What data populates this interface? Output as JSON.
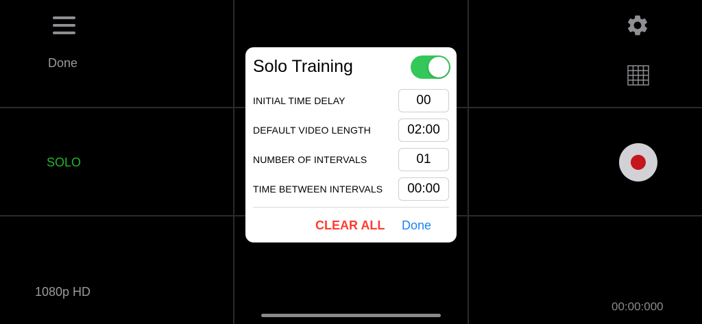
{
  "left_panel": {
    "done_label": "Done",
    "mode_label": "SOLO",
    "resolution_label": "1080p HD"
  },
  "right_panel": {
    "timer_label": "00:00:000"
  },
  "dialog": {
    "title": "Solo Training",
    "toggle_on": true,
    "rows": [
      {
        "label": "INITIAL TIME DELAY",
        "value": "00"
      },
      {
        "label": "DEFAULT VIDEO LENGTH",
        "value": "02:00"
      },
      {
        "label": "NUMBER OF INTERVALS",
        "value": "01"
      },
      {
        "label": "TIME BETWEEN INTERVALS",
        "value": "00:00"
      }
    ],
    "clear_label": "CLEAR ALL",
    "done_label": "Done"
  },
  "icons": {
    "menu": "hamburger-menu-icon",
    "settings": "gear-icon",
    "grid": "grid-icon",
    "record": "record-icon"
  },
  "colors": {
    "mode_active": "#20b726",
    "toggle_on": "#34c759",
    "destructive": "#ff3b30",
    "link": "#1a84f0",
    "record": "#c4161c"
  }
}
